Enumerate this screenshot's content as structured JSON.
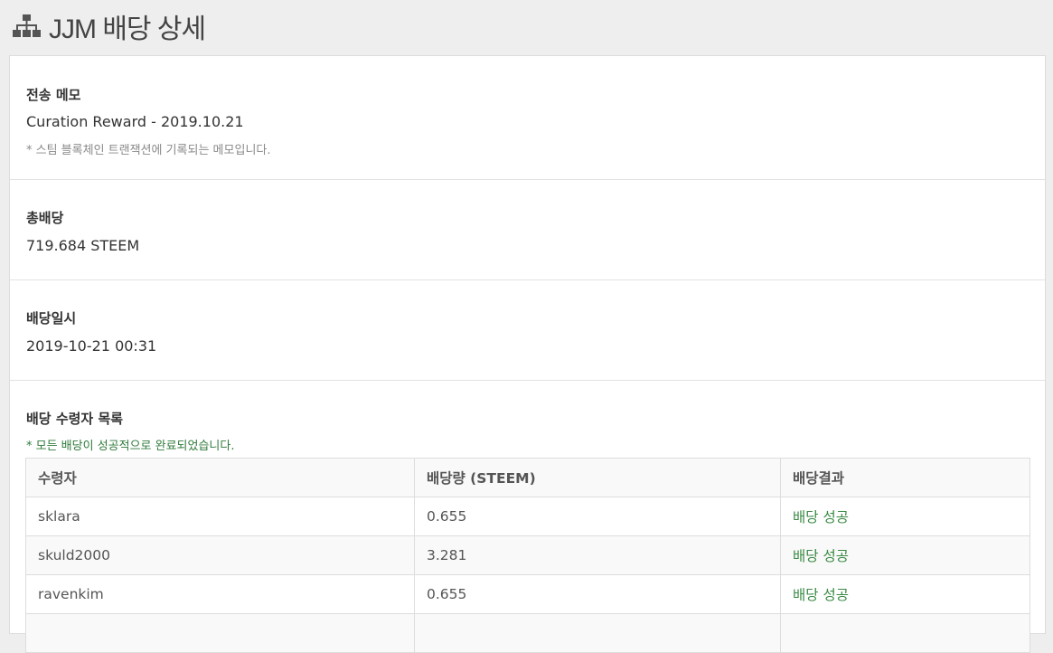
{
  "header": {
    "title": "JJM 배당 상세",
    "icon": "sitemap-icon"
  },
  "memo": {
    "label": "전송 메모",
    "value": "Curation Reward - 2019.10.21",
    "note": "* 스팀 블록체인 트랜잭션에 기록되는 메모입니다."
  },
  "total": {
    "label": "총배당",
    "value": "719.684 STEEM"
  },
  "date": {
    "label": "배당일시",
    "value": "2019-10-21 00:31"
  },
  "recipients": {
    "label": "배당 수령자 목록",
    "note": "* 모든 배당이 성공적으로 완료되었습니다.",
    "columns": [
      "수령자",
      "배당량 (STEEM)",
      "배당결과"
    ],
    "rows": [
      {
        "name": "sklara",
        "amount": "0.655",
        "result": "배당 성공"
      },
      {
        "name": "skuld2000",
        "amount": "3.281",
        "result": "배당 성공"
      },
      {
        "name": "ravenkim",
        "amount": "0.655",
        "result": "배당 성공"
      }
    ]
  },
  "colors": {
    "success": "#3a8a44",
    "note": "#8a8a8a"
  }
}
